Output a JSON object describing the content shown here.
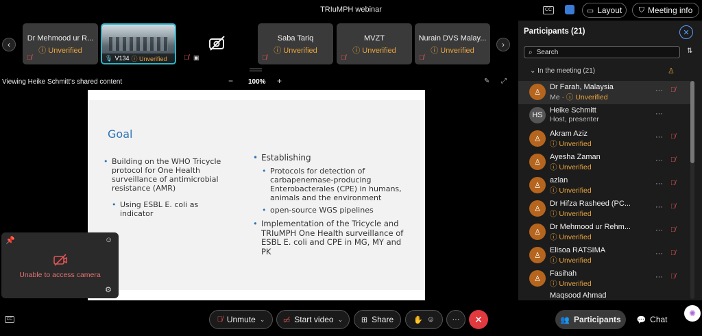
{
  "app": {
    "title": "TRIuMPH webinar",
    "layout_label": "Layout",
    "meeting_info_label": "Meeting info",
    "cc_label": "CC"
  },
  "tiles": [
    {
      "name": "Dr Mehmood ur R...",
      "status": "Unverified"
    },
    {
      "name": "V134",
      "status": "Unverified"
    },
    {
      "name": "",
      "status": ""
    },
    {
      "name": "Saba Tariq",
      "status": "Unverified"
    },
    {
      "name": "MVZT",
      "status": "Unverified"
    },
    {
      "name": "Nurain DVS Malay...",
      "status": "Unverified"
    }
  ],
  "share": {
    "viewing": "Viewing Heike Schmitt's shared content",
    "zoom": "100%",
    "minus": "−",
    "plus": "+"
  },
  "slide": {
    "title": "Goal",
    "left_bullet": "Building on the WHO Tricycle protocol for One Health surveillance of antimicrobial resistance (AMR)",
    "left_sub": "Using ESBL E. coli as indicator",
    "right_bullet1": "Establishing",
    "right_sub1": "Protocols for detection of carbapenemase-producing Enterobacterales (CPE) in humans, animals and the environment",
    "right_sub2": "open-source WGS pipelines",
    "right_bullet2": "Implementation of the Tricycle and TRIuMPH One Health surveillance of ESBL E. coli and CPE in MG, MY and PK"
  },
  "selfview": {
    "message": "Unable to access camera"
  },
  "participants": {
    "title": "Participants (21)",
    "search_placeholder": "Search",
    "section": "In the meeting (21)",
    "list": [
      {
        "name": "Dr Farah, Malaysia",
        "me": "Me",
        "status": "Unverified",
        "initials": ""
      },
      {
        "name": "Heike Schmitt",
        "status": "Host, presenter",
        "initials": "HS"
      },
      {
        "name": "Akram Aziz",
        "status": "Unverified",
        "initials": ""
      },
      {
        "name": "Ayesha Zaman",
        "status": "Unverified",
        "initials": ""
      },
      {
        "name": "azlan",
        "status": "Unverified",
        "initials": ""
      },
      {
        "name": "Dr Hifza Rasheed (PC...",
        "status": "Unverified",
        "initials": ""
      },
      {
        "name": "Dr Mehmood ur Rehm...",
        "status": "Unverified",
        "initials": ""
      },
      {
        "name": "Elisoa RATSIMA",
        "status": "Unverified",
        "initials": ""
      },
      {
        "name": "Fasihah",
        "status": "Unverified",
        "initials": ""
      },
      {
        "name": "Maqsood Ahmad",
        "status": "",
        "initials": ""
      }
    ]
  },
  "controls": {
    "unmute": "Unmute",
    "start_video": "Start video",
    "share": "Share",
    "participants": "Participants",
    "chat": "Chat",
    "cc": "CC"
  },
  "colors": {
    "accent": "#e8a33d",
    "danger": "#e0393e",
    "slide_title": "#2e74b5"
  }
}
